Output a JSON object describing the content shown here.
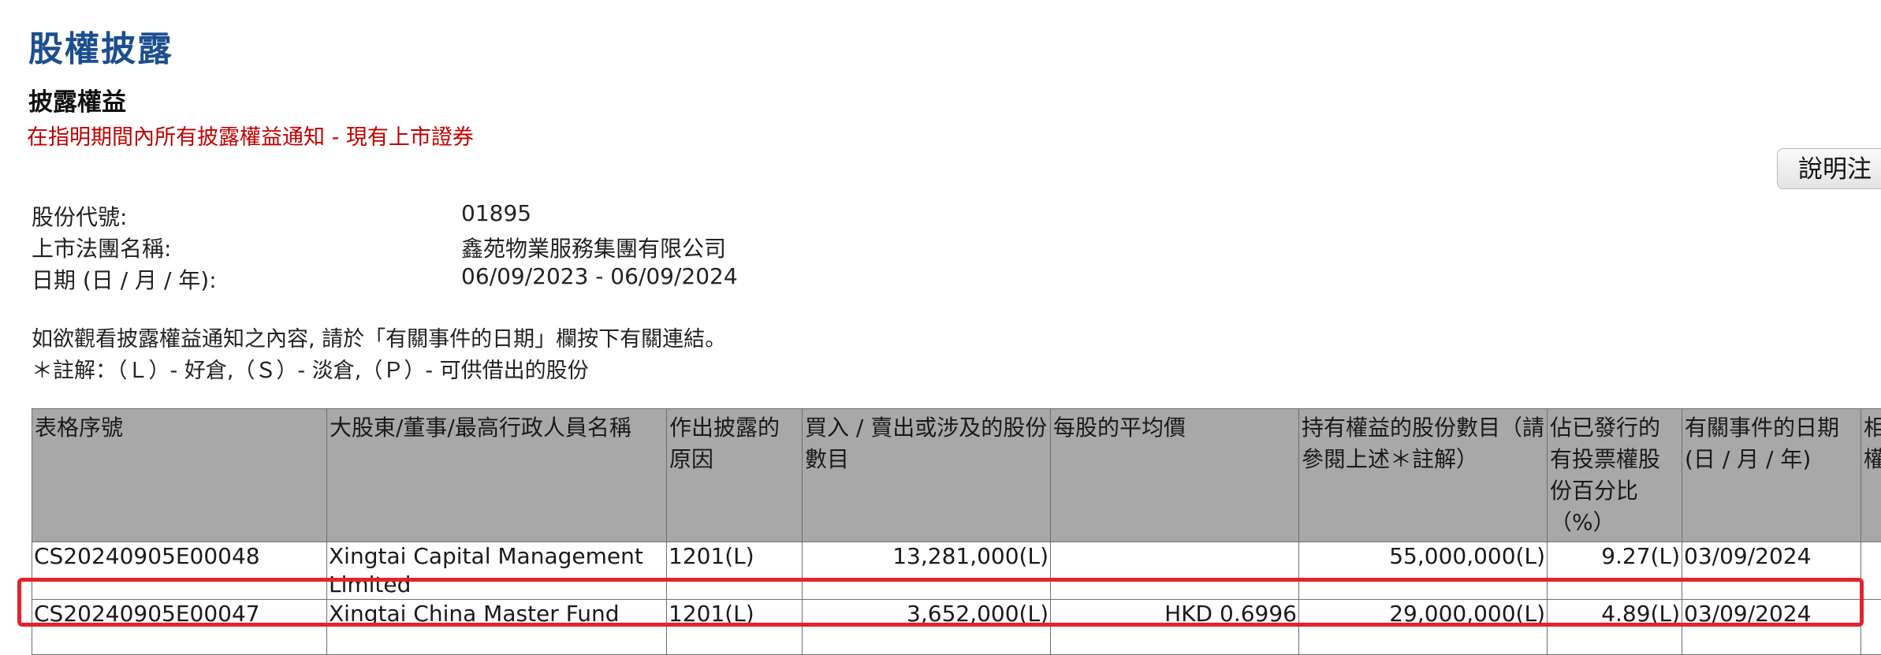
{
  "header": {
    "page_title": "股權披露",
    "section_title": "披露權益",
    "subtitle": "在指明期間內所有披露權益通知 - 現有上市證券",
    "help_button": "說明注"
  },
  "info": {
    "stock_code_label": "股份代號:",
    "stock_code_value": "01895",
    "corp_name_label": "上市法團名稱:",
    "corp_name_value": "鑫苑物業服務集團有限公司",
    "date_label": "日期 (日 / 月 / 年):",
    "date_value": "06/09/2023 - 06/09/2024"
  },
  "notes": {
    "line1": "如欲觀看披露權益通知之內容, 請於「有關事件的日期」欄按下有關連結。",
    "line2": "＊註解：（Ｌ）- 好倉,（Ｓ）- 淡倉,（Ｐ）- 可供借出的股份"
  },
  "table": {
    "headers": [
      "表格序號",
      "大股東/董事/最高行政人員名稱",
      "作出披露的原因",
      "買入 / 賣出或涉及的股份數目",
      "每股的平均價",
      "持有權益的股份數目（請參閱上述＊註解）",
      "佔已發行的有投票權股份百分比（%）",
      "有關事件的日期(日 / 月 / 年)",
      "相關權"
    ],
    "rows": [
      {
        "form_no": "CS20240905E00048",
        "name": "Xingtai Capital Management Limited",
        "reason": "1201(L)",
        "shares_traded": "13,281,000(L)",
        "avg_price": "",
        "shares_held": "55,000,000(L)",
        "percent": "9.27(L)",
        "event_date": "03/09/2024"
      },
      {
        "form_no": "CS20240905E00047",
        "name": "Xingtai China Master Fund",
        "reason": "1201(L)",
        "shares_traded": "3,652,000(L)",
        "avg_price": "HKD 0.6996",
        "shares_held": "29,000,000(L)",
        "percent": "4.89(L)",
        "event_date": "03/09/2024"
      }
    ]
  },
  "colors": {
    "title_blue": "#1c4f8f",
    "subtitle_red": "#c00000",
    "header_gray": "#a8a8a8",
    "highlight_red": "#e3232a"
  }
}
